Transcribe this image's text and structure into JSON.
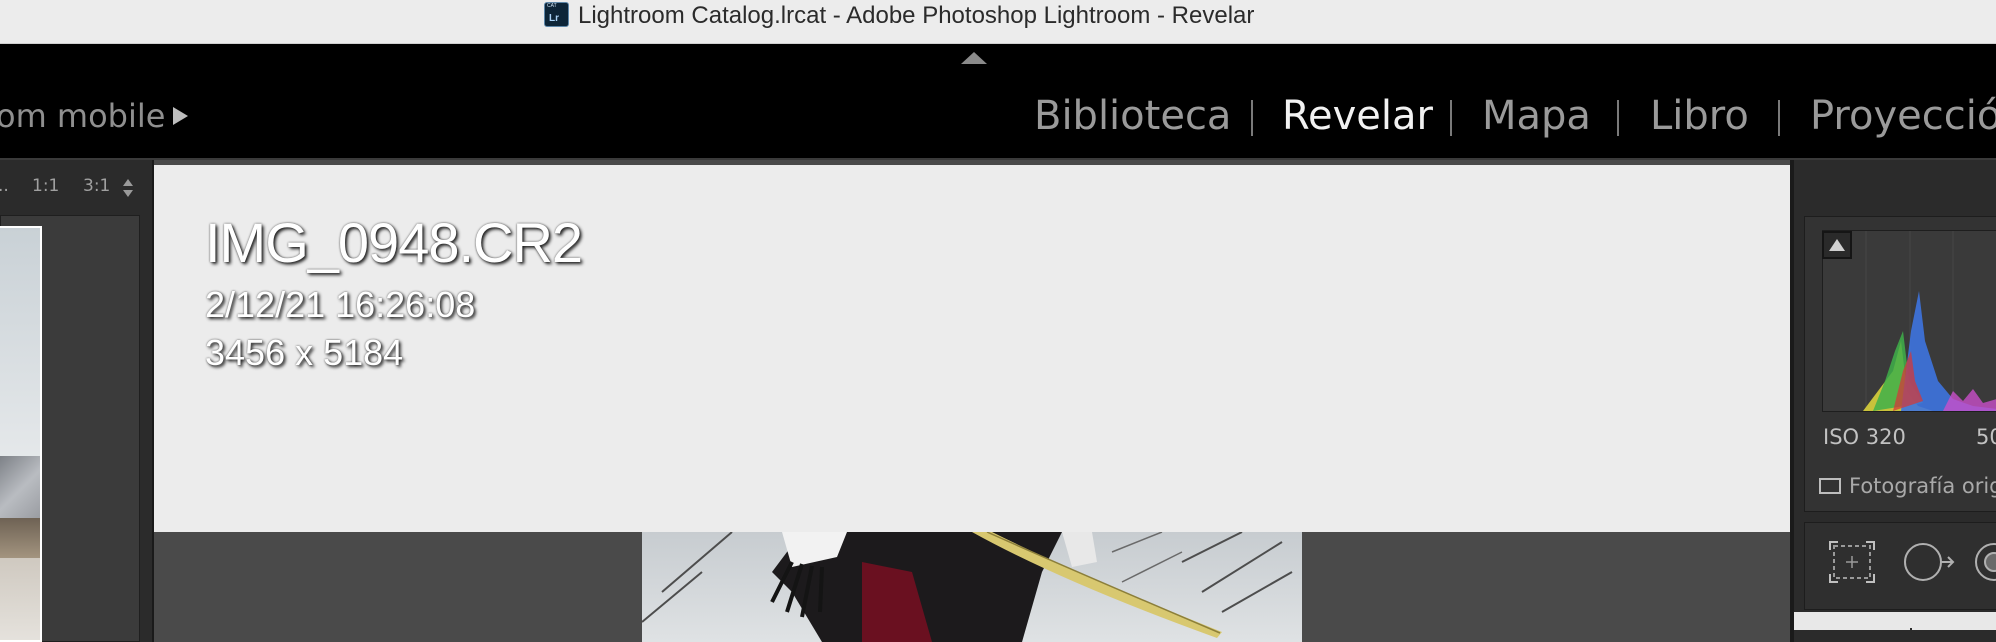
{
  "window": {
    "title": "Lightroom Catalog.lrcat - Adobe Photoshop Lightroom - Revelar",
    "doc_icon_text": "Lr",
    "doc_icon_tag": "CAT"
  },
  "top_panel": {
    "mobile_label": "om mobile",
    "modules": [
      {
        "label": "Biblioteca",
        "active": false
      },
      {
        "label": "Revelar",
        "active": true
      },
      {
        "label": "Mapa",
        "active": false
      },
      {
        "label": "Libro",
        "active": false
      },
      {
        "label": "Proyecció",
        "active": false
      }
    ]
  },
  "navigator": {
    "zoom_fill": "..",
    "zoom_1to1": "1:1",
    "zoom_3to1": "3:1"
  },
  "info_overlay": {
    "filename": "IMG_0948.CR2",
    "datetime": "2/12/21 16:26:08",
    "dimensions": "3456 x 5184"
  },
  "right_panel": {
    "iso": "ISO 320",
    "exposure_partial": "50",
    "show_original_label": "Fotografía orig"
  },
  "colors": {
    "background": "#000000",
    "panel": "#2b2b2b",
    "info_overlay": "#ececec",
    "active_module": "#f2f2f2",
    "inactive_module": "#9a9a9a"
  }
}
